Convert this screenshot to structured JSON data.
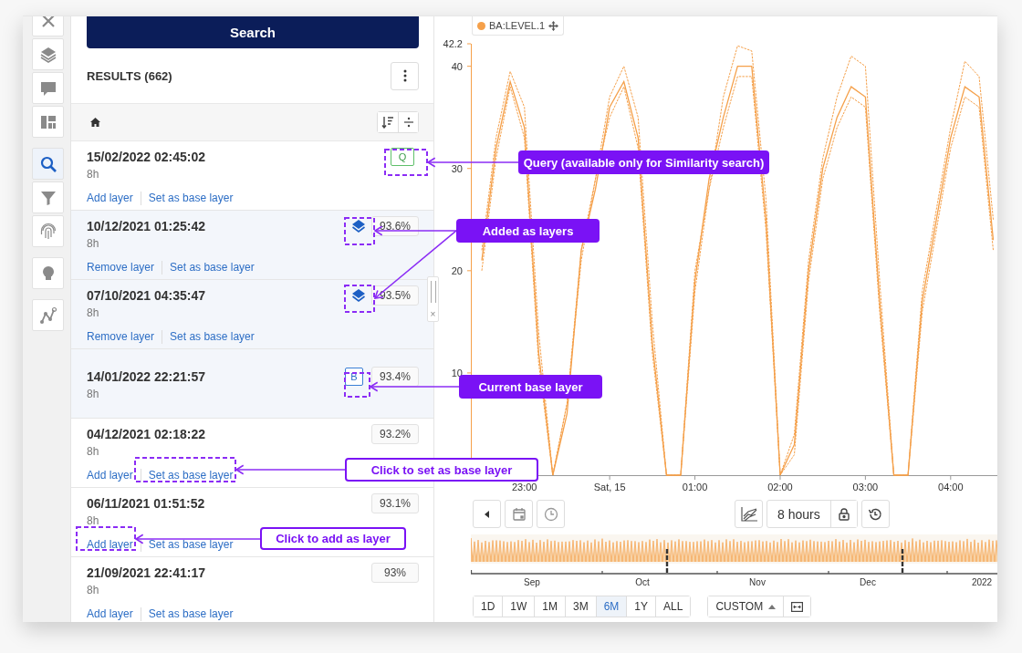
{
  "sidebar": {
    "groups": [
      {
        "items": [
          {
            "kind": "tools",
            "selected": false
          },
          {
            "kind": "layers",
            "selected": false
          },
          {
            "kind": "comment",
            "selected": false
          },
          {
            "kind": "dashboard",
            "selected": false
          }
        ]
      },
      {
        "items": [
          {
            "kind": "search",
            "selected": true
          },
          {
            "kind": "filter",
            "selected": false
          },
          {
            "kind": "fingerprint",
            "selected": false
          }
        ]
      },
      {
        "items": [
          {
            "kind": "bulb",
            "selected": false
          }
        ]
      },
      {
        "items": [
          {
            "kind": "graph",
            "selected": false
          }
        ]
      }
    ]
  },
  "search_button": "Search",
  "results": {
    "title": "RESULTS (662)",
    "rows": [
      {
        "date": "15/02/2022 02:45:02",
        "duration": "8h",
        "kind": "query",
        "badge": "Q",
        "links": [
          "Add layer",
          "Set as base layer"
        ]
      },
      {
        "date": "10/12/2021 01:25:42",
        "duration": "8h",
        "kind": "layer",
        "score": "93.6%",
        "links": [
          "Remove layer",
          "Set as base layer"
        ]
      },
      {
        "date": "07/10/2021 04:35:47",
        "duration": "8h",
        "kind": "layer",
        "score": "93.5%",
        "links": [
          "Remove layer",
          "Set as base layer"
        ]
      },
      {
        "date": "14/01/2022 22:21:57",
        "duration": "8h",
        "kind": "base",
        "badge": "B",
        "score": "93.4%"
      },
      {
        "date": "04/12/2021 02:18:22",
        "duration": "8h",
        "kind": "none",
        "score": "93.2%",
        "links": [
          "Add layer",
          "Set as base layer"
        ]
      },
      {
        "date": "06/11/2021 01:51:52",
        "duration": "8h",
        "kind": "none",
        "score": "93.1%",
        "links": [
          "Add layer",
          "Set as base layer"
        ]
      },
      {
        "date": "21/09/2021 22:41:17",
        "duration": "8h",
        "kind": "none",
        "score": "93%",
        "links": [
          "Add layer",
          "Set as base layer"
        ]
      }
    ]
  },
  "splitter": {
    "close": "×"
  },
  "chart": {
    "chart_data": {
      "type": "line",
      "categories": [
        null,
        null,
        null,
        "23:00",
        null,
        null,
        null,
        null,
        null,
        "Sat, 15",
        null,
        null,
        null,
        null,
        null,
        "01:00",
        null,
        null,
        null,
        null,
        null,
        "02:00",
        null,
        null,
        null,
        null,
        null,
        "03:00",
        null,
        null,
        null,
        null,
        null,
        "04:00",
        null,
        null,
        null
      ],
      "series": [
        {
          "name": "BA:LEVEL.1",
          "color": "#f5a04a",
          "line_style": "solid",
          "values": [
            21,
            32,
            38.5,
            34,
            12,
            0,
            6,
            22,
            28,
            36,
            38.5,
            33,
            13,
            0,
            0,
            19,
            29,
            35,
            40,
            40,
            25,
            0,
            3,
            20,
            30,
            35,
            38,
            37,
            17,
            0,
            0,
            17,
            25,
            33,
            38,
            37,
            23
          ]
        },
        {
          "color": "#f5a04a",
          "line_style": "dotted",
          "values": [
            22,
            33,
            39.5,
            36,
            14,
            0,
            7,
            22,
            29,
            37,
            40,
            35,
            15,
            0,
            0,
            20,
            28,
            37,
            42,
            41.5,
            27,
            0,
            4,
            21,
            31,
            37,
            41,
            40,
            19,
            0,
            0,
            18,
            26,
            34,
            40.5,
            39,
            25
          ]
        },
        {
          "color": "#f5a04a",
          "line_style": "dotted",
          "values": [
            20,
            31,
            38,
            33,
            11,
            0,
            7,
            21,
            29,
            35,
            38,
            32,
            12,
            0,
            0,
            18,
            28,
            34,
            39,
            39,
            24,
            0,
            2,
            19,
            29,
            34,
            37,
            36,
            16,
            0,
            0,
            16,
            24,
            32,
            37,
            36,
            22
          ]
        }
      ],
      "ylim": [
        0,
        42.2
      ],
      "yticks": [
        10,
        20,
        30,
        40,
        42.2
      ]
    }
  },
  "controls": {
    "duration": "8 hours",
    "ranges": [
      {
        "label": "1D",
        "selected": false
      },
      {
        "label": "1W",
        "selected": false
      },
      {
        "label": "1M",
        "selected": false
      },
      {
        "label": "3M",
        "selected": false
      },
      {
        "label": "6M",
        "selected": true
      },
      {
        "label": "1Y",
        "selected": false
      },
      {
        "label": "ALL",
        "selected": false
      }
    ],
    "custom": "CUSTOM"
  },
  "navigator": {
    "labels": [
      "Sep",
      "Oct",
      "Nov",
      "Dec",
      "2022"
    ]
  },
  "annotations": [
    {
      "kind": "filled",
      "text": "Query (available only for Similarity search)"
    },
    {
      "kind": "filled",
      "text": "Added as layers"
    },
    {
      "kind": "filled",
      "text": "Current base layer"
    },
    {
      "kind": "outlined",
      "text": "Click to set as base layer"
    },
    {
      "kind": "outlined",
      "text": "Click to add as layer"
    }
  ]
}
